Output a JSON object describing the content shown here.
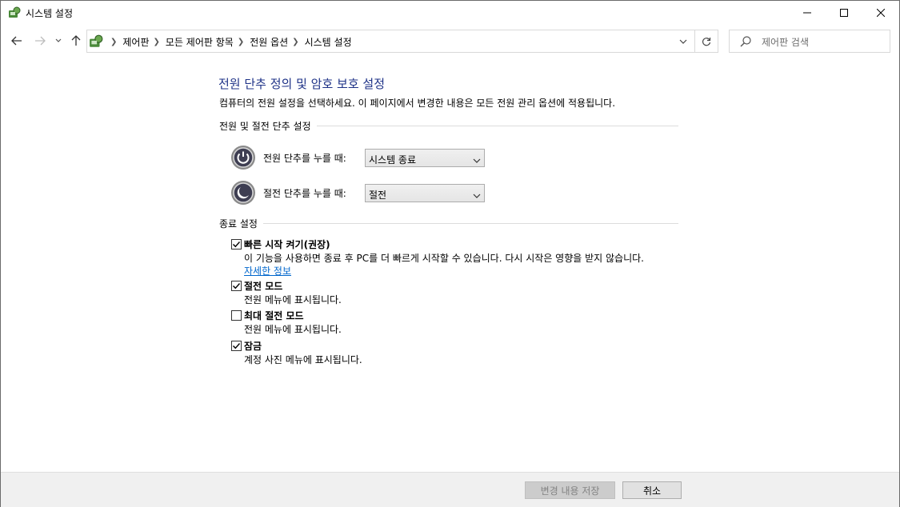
{
  "window": {
    "title": "시스템 설정"
  },
  "navigation": {
    "breadcrumbs": [
      "제어판",
      "모든 제어판 항목",
      "전원 옵션",
      "시스템 설정"
    ],
    "search_placeholder": "제어판 검색"
  },
  "main": {
    "title": "전원 단추 정의 및 암호 보호 설정",
    "description": "컴퓨터의 전원 설정을 선택하세요. 이 페이지에서 변경한 내용은 모든 전원 관리 옵션에 적용됩니다.",
    "power_section": {
      "heading": "전원 및 절전 단추 설정",
      "power_button_label": "전원 단추를 누를 때:",
      "power_button_value": "시스템 종료",
      "sleep_button_label": "절전 단추를 누를 때:",
      "sleep_button_value": "절전"
    },
    "shutdown_section": {
      "heading": "종료 설정",
      "options": [
        {
          "label": "빠른 시작 켜기(권장)",
          "desc": "이 기능을 사용하면 종료 후 PC를 더 빠르게 시작할 수 있습니다. 다시 시작은 영향을 받지 않습니다.",
          "link": "자세한 정보",
          "checked": true
        },
        {
          "label": "절전 모드",
          "desc": "전원 메뉴에 표시됩니다.",
          "checked": true
        },
        {
          "label": "최대 절전 모드",
          "desc": "전원 메뉴에 표시됩니다.",
          "checked": false
        },
        {
          "label": "잠금",
          "desc": "계정 사진 메뉴에 표시됩니다.",
          "checked": true
        }
      ]
    }
  },
  "footer": {
    "save_label": "변경 내용 저장",
    "cancel_label": "취소"
  },
  "colors": {
    "title_blue": "#1e3287",
    "link_blue": "#0066cc"
  }
}
